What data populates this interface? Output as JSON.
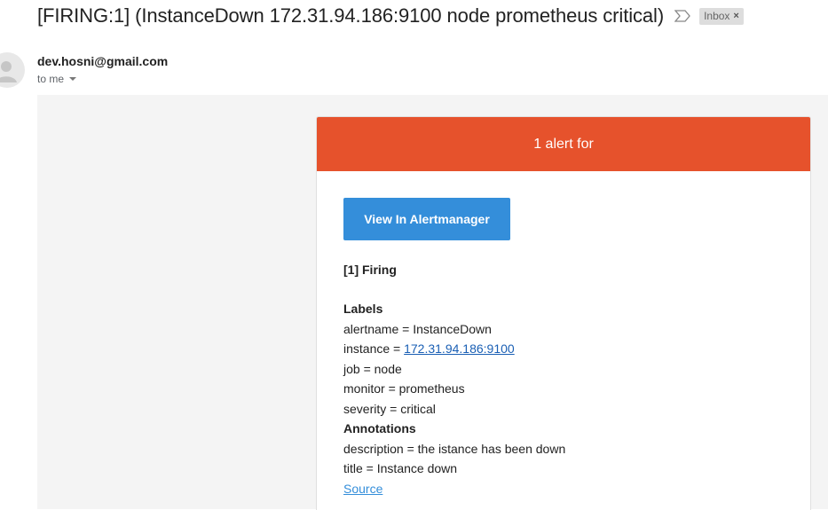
{
  "email": {
    "subject": "[FIRING:1] (InstanceDown 172.31.94.186:9100 node prometheus critical)",
    "badge": "Inbox",
    "badge_close": "×",
    "sender": "dev.hosni@gmail.com",
    "recipient": "to me"
  },
  "alert": {
    "header": "1 alert for",
    "button_label": "View In Alertmanager",
    "firing_title": "[1] Firing",
    "labels_title": "Labels",
    "labels": [
      {
        "key": "alertname = ",
        "value": "InstanceDown"
      },
      {
        "key": "instance = ",
        "value": "172.31.94.186:9100"
      },
      {
        "key": "job = ",
        "value": "node"
      },
      {
        "key": "monitor = ",
        "value": "prometheus"
      },
      {
        "key": "severity = ",
        "value": "critical"
      }
    ],
    "annotations_title": "Annotations",
    "annotations": [
      {
        "key": "description = ",
        "value": "the istance has been down"
      },
      {
        "key": "title = ",
        "value": "Instance down"
      }
    ],
    "source_link": "Source"
  },
  "colors": {
    "header_bg": "#e6522c",
    "button_bg": "#348eda",
    "link": "#1a5fb4"
  },
  "icons": [
    "important-marker-icon",
    "avatar-person-icon",
    "dropdown-caret-icon",
    "badge-close-icon"
  ]
}
